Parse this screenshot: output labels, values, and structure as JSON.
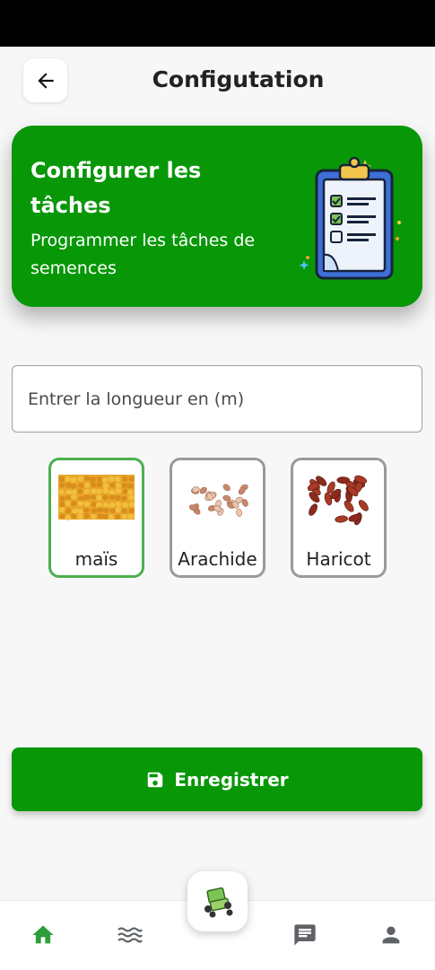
{
  "header": {
    "title": "Configutation",
    "back_icon": "arrow-left-icon"
  },
  "banner": {
    "title": "Configurer les tâches",
    "subtitle": "Programmer les tâches de semences",
    "illustration": "clipboard-checklist-icon",
    "background_color": "#079707"
  },
  "length_field": {
    "value": "",
    "placeholder": "Entrer la longueur en (m)"
  },
  "seeds": [
    {
      "label": "maïs",
      "selected": true,
      "image": "corn-kernels"
    },
    {
      "label": "Arachide",
      "selected": false,
      "image": "peanuts"
    },
    {
      "label": "Haricot",
      "selected": false,
      "image": "red-beans"
    }
  ],
  "save_button": {
    "label": "Enregistrer",
    "icon": "floppy-disk-icon"
  },
  "bottom_nav": {
    "items": [
      {
        "icon": "home-icon",
        "active": true
      },
      {
        "icon": "waves-icon",
        "active": false
      },
      {
        "icon": "robot-vehicle-icon",
        "active": false
      },
      {
        "icon": "chat-icon",
        "active": false
      },
      {
        "icon": "profile-icon",
        "active": false
      }
    ]
  },
  "colors": {
    "primary": "#079707",
    "selected_border": "#4caf50",
    "unselected_border": "#9a9a9a",
    "nav_active": "#2e9e3a",
    "nav_inactive": "#5f6368"
  }
}
